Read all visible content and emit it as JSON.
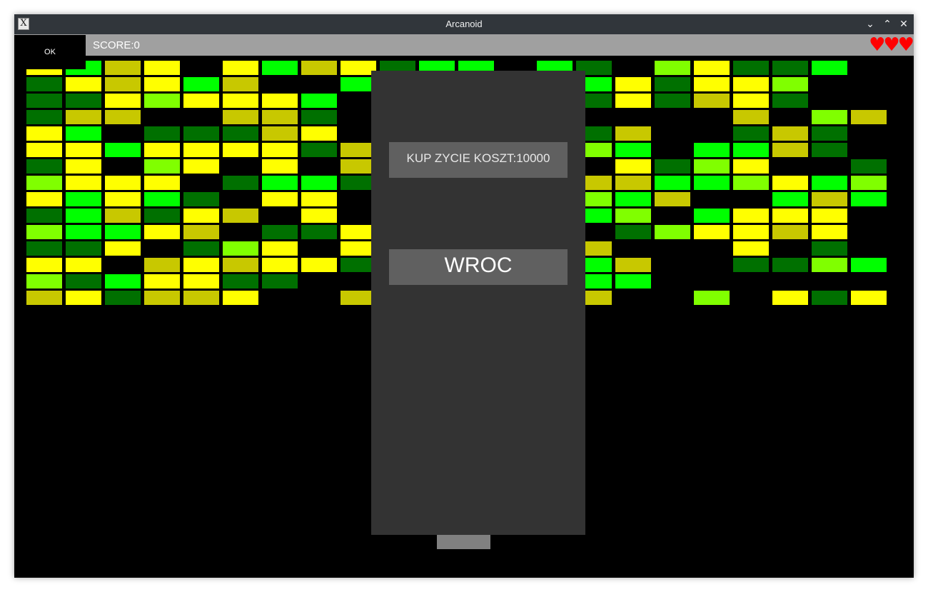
{
  "window": {
    "title": "Arcanoid",
    "app_icon_glyph": "X",
    "controls": {
      "minimize": "⌄",
      "maximize": "⌃",
      "close": "✕"
    }
  },
  "hud": {
    "score_text": "SCORE:0",
    "lives": 3,
    "hearts": "♥♥♥",
    "ok_label": "OK"
  },
  "modal": {
    "buy_life_label": "KUP ZYCIE KOSZT:10000",
    "back_label": "WROC"
  },
  "colors": {
    "dark-green": "#007000",
    "olive": "#c8c800",
    "yellow": "#ffff00",
    "lime": "#80ff00",
    "bright-green": "#00ff00"
  },
  "brick_grid": [
    "YGOY.YGOYDGG.GD.LYDDG",
    "DYOYGO..G....YGYDYYL",
    "DDYLYYYG.....YDYDOYD",
    "DOO..OOD.....Y....O.LO",
    "YG.DDDOY.....GDO..DOD",
    "YYGYYYYDO....OLG.GGOD",
    "DY.LY.Y.O....Y.YDLY..D",
    "LYYY.DGGD....YOOGGLYGL",
    "YGYGD.YY......LGO..GOG",
    "DGODYO.Y.....YGL.GYYY",
    "LGGYO.DDY....G.DLYYOY",
    "DDY.DLY.Y....YO...Y.D.",
    "YY.OYOYYD....YGO..DDLG",
    "LDGYYDD......GGG",
    "OYDOOY..O....OO..L.YDY"
  ]
}
